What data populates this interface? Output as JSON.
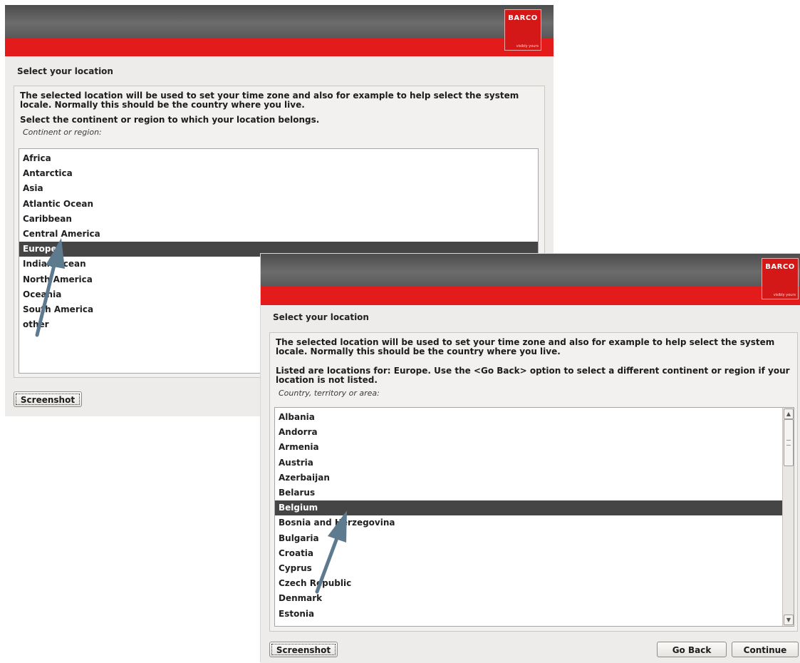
{
  "brand": {
    "logo_text": "BARCO",
    "tagline": "visibly yours"
  },
  "screen1": {
    "page_title": "Select your location",
    "help_text": "The selected location will be used to set your time zone and also for example to help select the system locale. Normally this should be the country where you live.",
    "prompt": "Select the continent or region to which your location belongs.",
    "list_label": "Continent or region:",
    "items": [
      "Africa",
      "Antarctica",
      "Asia",
      "Atlantic Ocean",
      "Caribbean",
      "Central America",
      "Europe",
      "Indian Ocean",
      "North America",
      "Oceania",
      "South America",
      "other"
    ],
    "selected": "Europe",
    "screenshot_label": "Screenshot"
  },
  "screen2": {
    "page_title": "Select your location",
    "help_text": "The selected location will be used to set your time zone and also for example to help select the system locale. Normally this should be the country where you live.",
    "prompt": "Listed are locations for: Europe. Use the <Go Back> option to select a different continent or region if your location is not listed.",
    "list_label": "Country, territory or area:",
    "items": [
      "Albania",
      "Andorra",
      "Armenia",
      "Austria",
      "Azerbaijan",
      "Belarus",
      "Belgium",
      "Bosnia and Herzegovina",
      "Bulgaria",
      "Croatia",
      "Cyprus",
      "Czech Republic",
      "Denmark",
      "Estonia"
    ],
    "selected": "Belgium",
    "screenshot_label": "Screenshot",
    "go_back_label": "Go Back",
    "continue_label": "Continue",
    "scroll_up_icon": "▲",
    "scroll_down_icon": "▼"
  },
  "colors": {
    "banner_red": "#e31b1b",
    "selection": "#454545",
    "arrow": "#5d7a8f"
  }
}
